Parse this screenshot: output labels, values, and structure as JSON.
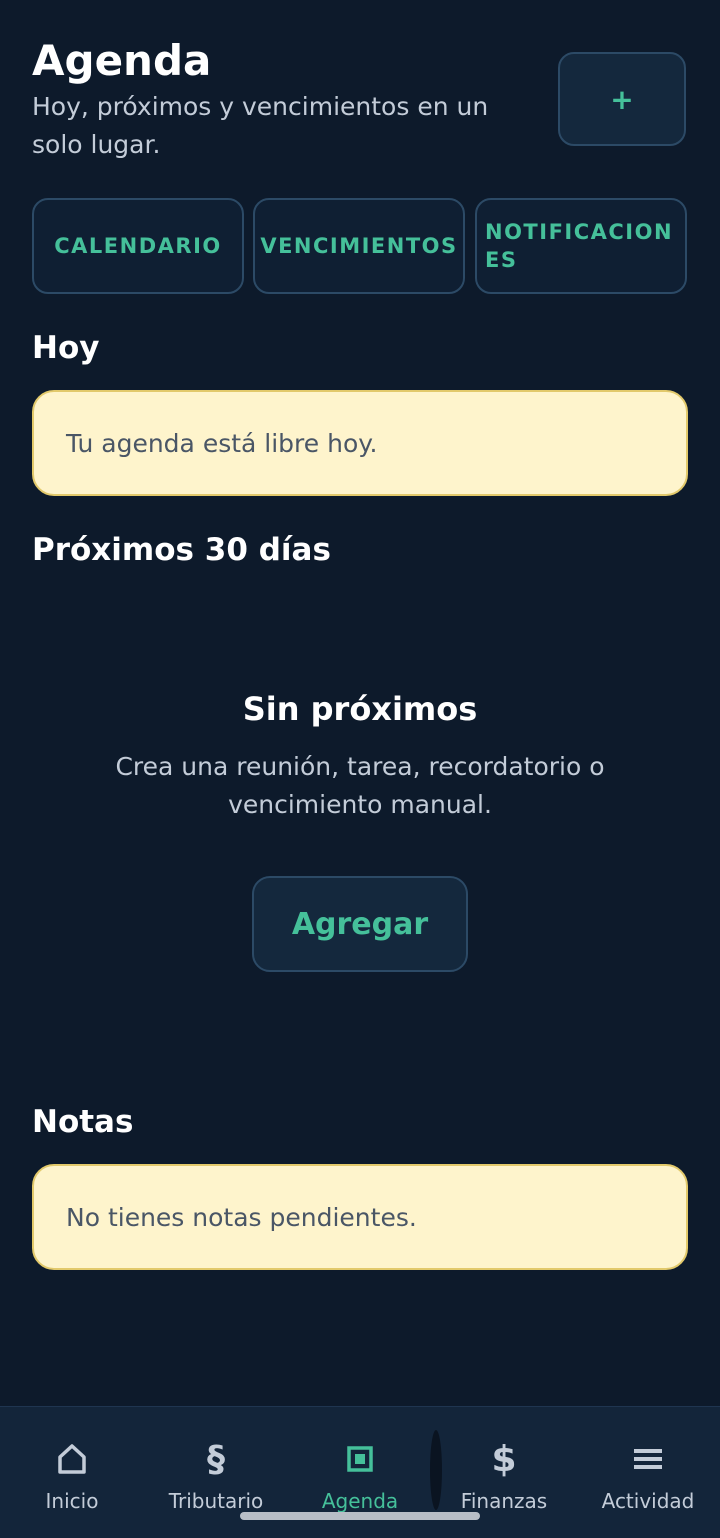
{
  "header": {
    "title": "Agenda",
    "subtitle": "Hoy, próximos y vencimientos en un solo lugar.",
    "add_label": "+"
  },
  "tabs": [
    {
      "label": "CALENDARIO"
    },
    {
      "label": "VENCIMIENTOS"
    },
    {
      "label": "NOTIFICACIONES"
    }
  ],
  "today": {
    "title": "Hoy",
    "message": "Tu agenda está libre hoy."
  },
  "upcoming": {
    "title": "Próximos 30 días",
    "empty_title": "Sin próximos",
    "empty_desc": "Crea una reunión, tarea, recordatorio o vencimiento manual.",
    "add_label": "Agregar"
  },
  "notes": {
    "title": "Notas",
    "message": "No tienes notas pendientes."
  },
  "nav": {
    "items": [
      {
        "label": "Inicio",
        "icon": "home-icon"
      },
      {
        "label": "Tributario",
        "icon": "section-icon"
      },
      {
        "label": "Agenda",
        "icon": "agenda-icon"
      },
      {
        "label": "Finanzas",
        "icon": "dollar-icon"
      },
      {
        "label": "Actividad",
        "icon": "menu-icon"
      }
    ],
    "active_index": 2
  },
  "colors": {
    "background": "#0d1a2b",
    "accent": "#45c09a",
    "card": "#fef4cc"
  }
}
